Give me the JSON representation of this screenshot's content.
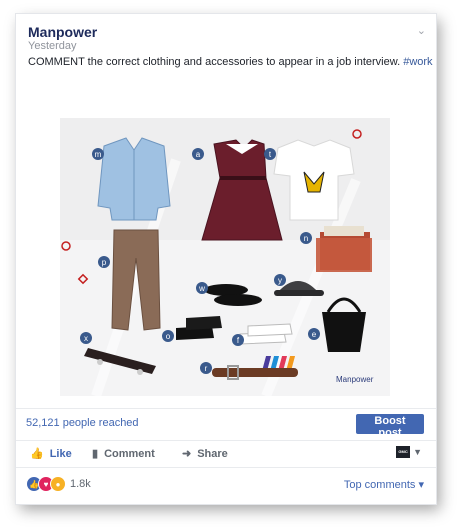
{
  "post": {
    "author": "Manpower",
    "time": "Yesterday",
    "text": "COMMENT the correct clothing and accessories to appear in a job interview.",
    "hashtag": "#work"
  },
  "image": {
    "labels": {
      "m": "m",
      "a": "a",
      "t": "t",
      "n": "n",
      "p": "p",
      "w": "w",
      "y": "y",
      "x": "x",
      "o": "o",
      "f": "f",
      "e": "e",
      "r": "r"
    },
    "logo_text": "Manpower",
    "badge_color": "#3a5a8c"
  },
  "stats": {
    "reach": "52,121 people reached",
    "boost_label": "Boost post"
  },
  "actions": {
    "like": "Like",
    "comment": "Comment",
    "share": "Share",
    "page_badge": "GMC"
  },
  "reactions": {
    "count": "1.8k",
    "top_comments": "Top comments"
  },
  "colors": {
    "accent": "#4267b2",
    "author": "#1d2a5b"
  }
}
